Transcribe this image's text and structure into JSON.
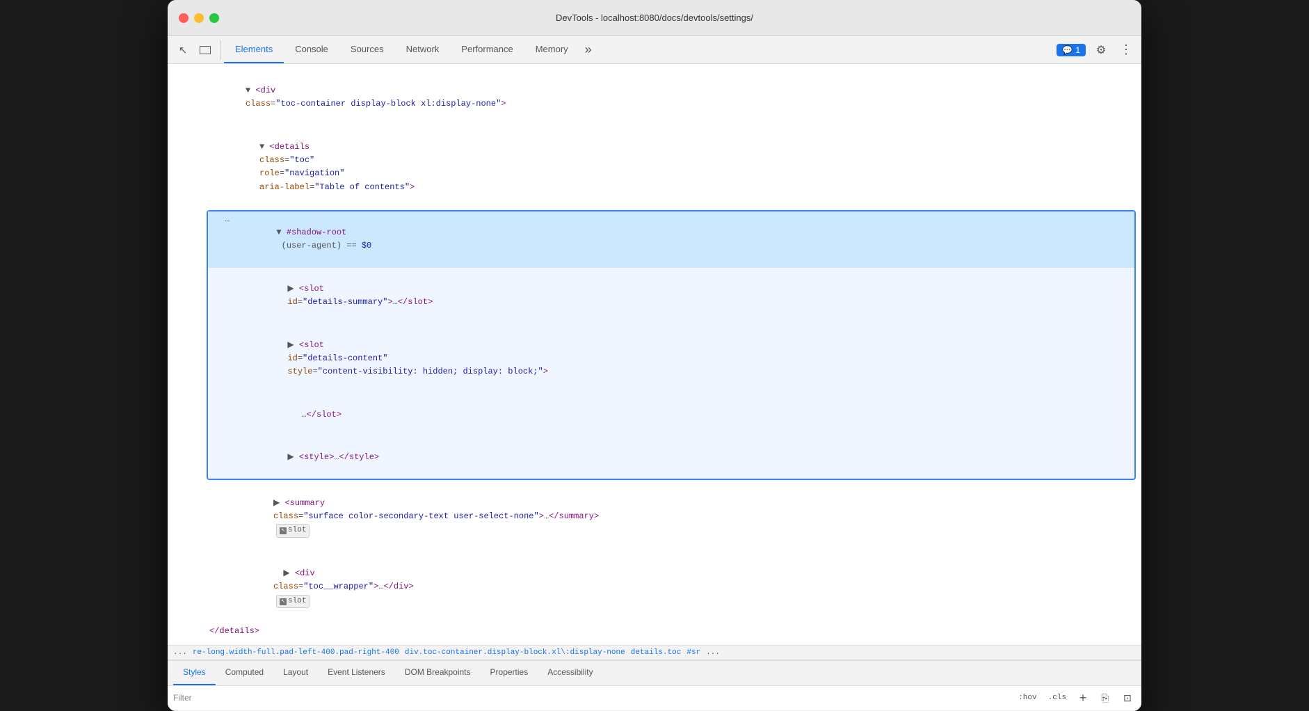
{
  "window": {
    "title": "DevTools - localhost:8080/docs/devtools/settings/"
  },
  "toolbar": {
    "tabs": [
      {
        "label": "Elements",
        "active": true
      },
      {
        "label": "Console",
        "active": false
      },
      {
        "label": "Sources",
        "active": false
      },
      {
        "label": "Network",
        "active": false
      },
      {
        "label": "Performance",
        "active": false
      },
      {
        "label": "Memory",
        "active": false
      }
    ],
    "more_label": "»",
    "comment_count": "1",
    "comment_label": "1"
  },
  "dom": {
    "line1": "▼ <div class=\"toc-container display-block xl:display-none\">",
    "line2": "  ▼ <details class=\"toc\" role=\"navigation\" aria-label=\"Table of contents\">",
    "shadow_root": {
      "header": "▼ #shadow-root (user-agent) == $0",
      "line1": "  ▶ <slot id=\"details-summary\">…</slot>",
      "line2": "  ▶ <slot id=\"details-content\" style=\"content-visibility: hidden; display: block;\">",
      "line2b": "      …</slot>",
      "line3": "  ▶ <style>…</style>"
    },
    "line3": "▶ <summary class=\"surface color-secondary-text user-select-none\">…</summary>",
    "slot_badge1": "slot",
    "line4": "  ▶ <div class=\"toc__wrapper\">…</div>",
    "slot_badge2": "slot",
    "line5": "  </details>"
  },
  "breadcrumb": {
    "items": [
      "...",
      "re-long.width-full.pad-left-400.pad-right-400",
      "div.toc-container.display-block.xl\\:display-none",
      "details.toc",
      "#sr",
      "..."
    ]
  },
  "bottom_tabs": [
    {
      "label": "Styles",
      "active": true
    },
    {
      "label": "Computed",
      "active": false
    },
    {
      "label": "Layout",
      "active": false
    },
    {
      "label": "Event Listeners",
      "active": false
    },
    {
      "label": "DOM Breakpoints",
      "active": false
    },
    {
      "label": "Properties",
      "active": false
    },
    {
      "label": "Accessibility",
      "active": false
    }
  ],
  "filter": {
    "placeholder": "Filter",
    "hov_label": ":hov",
    "cls_label": ".cls",
    "plus_label": "+",
    "new_style_rule_title": "New style rule",
    "toggle_element_state_title": "Toggle element state"
  }
}
